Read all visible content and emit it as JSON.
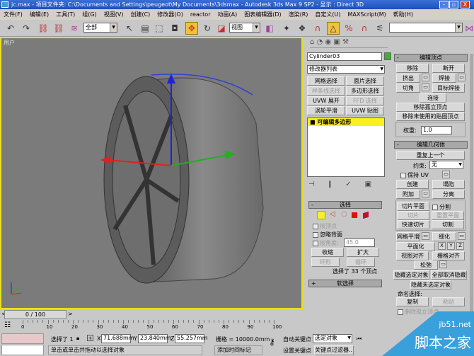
{
  "title": {
    "text": "jc.max   - 项目文件夹: C:\\Documents and Settings\\peugeot\\My Documents\\3dsmax    - Autodesk 3ds Max 9 SP2    - 显示 : Direct 3D",
    "min": "–",
    "max": "▫",
    "close": "X"
  },
  "menu": [
    "文件(F)",
    "编辑(E)",
    "工具(T)",
    "组(G)",
    "视图(V)",
    "创建(C)",
    "修改器(O)",
    "reactor",
    "动画(A)",
    "图表编辑器(D)",
    "渲染(R)",
    "自定义(U)",
    "MAXScript(M)",
    "帮助(H)"
  ],
  "toolbar": {
    "filter": "全部",
    "coord": "视图",
    "named_sel": ""
  },
  "viewport": {
    "label": "用户"
  },
  "cmd": {
    "object_name": "Cylinder03",
    "object_color": "#3cb030",
    "modifier_list": "修改器列表",
    "mod_buttons": [
      "网格选择",
      "面片选择",
      "样条线选择",
      "多边形选择",
      "UVW 展开",
      "FFD 选择",
      "涡轮平滑",
      "UVW 贴图"
    ],
    "stack_item": "可编辑多边形",
    "select_rollout": "选择",
    "by_vertex": "按顶点",
    "ignore_back": "忽略背面",
    "by_angle": "按角度:",
    "angle_val": "45.0",
    "shrink": "收缩",
    "grow": "扩大",
    "ring": "环形",
    "loop": "循环",
    "sel_status": "选择了 33 个顶点",
    "soft_sel": "软选择",
    "edit_vertex": "编辑顶点",
    "remove": "移除",
    "break": "断开",
    "extrude": "挤出",
    "weld": "焊接",
    "chamfer": "切角",
    "target_weld": "目标焊接",
    "connect": "连接",
    "remove_iso": "移除孤立顶点",
    "remove_unused": "移除未使用的贴图顶点",
    "weight_label": "权重:",
    "weight": "1.0",
    "edit_geom": "编辑几何体",
    "repeat": "重复上一个",
    "constraint": "约束:",
    "constraint_val": "无",
    "preserve_uv": "保持 UV",
    "create": "创建",
    "collapse": "塌陷",
    "attach": "附加",
    "detach": "分离",
    "slice_plane": "切片平面",
    "split": "分割",
    "slice": "切片",
    "reset_plane": "重置平面",
    "quickslice": "快速切片",
    "cut": "切割",
    "meshsmooth": "网格平滑",
    "tessellate": "细化",
    "planar": "平面化",
    "x": "X",
    "y": "Y",
    "z": "Z",
    "view_align": "视图对齐",
    "grid_align": "栅格对齐",
    "relax": "松弛",
    "hide_sel": "隐藏选定对象",
    "unhide_all": "全部取消隐藏",
    "hide_unsel": "隐藏未选定对象",
    "named_sel": "命名选择:",
    "copy": "复制",
    "paste": "粘贴",
    "delete_iso": "删除孤立顶点"
  },
  "timeline": {
    "frame": "0 / 100",
    "ticks": [
      "0",
      "10",
      "20",
      "30",
      "40",
      "50",
      "60",
      "70",
      "80",
      "90",
      "100"
    ]
  },
  "status": {
    "selected": "选择了 1",
    "x": "71.688mm",
    "y": "23.840mm",
    "z": "55.257mm",
    "grid": "栅格 = 10000.0mm",
    "prompt": "单击或单击并拖动以选择对象",
    "add_tag": "添加时间标记",
    "auto_key": "自动关键点",
    "set_key": "设置关键点",
    "sel_obj": "选定对象",
    "key_filter": "关键点过滤器..."
  },
  "watermark": {
    "site": "jb51.net",
    "name": "脚本之家"
  }
}
